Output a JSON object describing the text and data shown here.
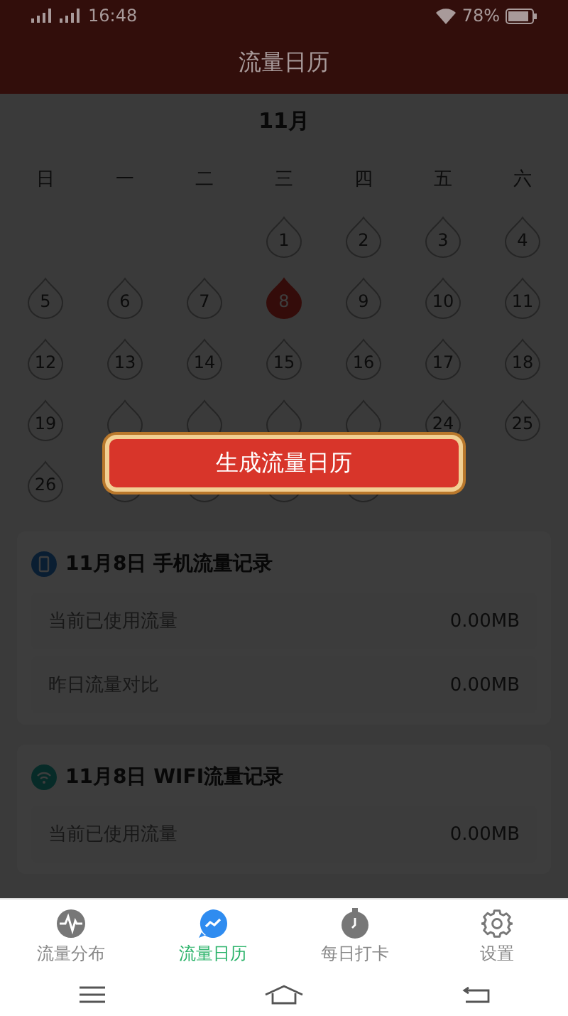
{
  "status_bar": {
    "time": "16:48",
    "battery": "78%"
  },
  "header": {
    "title": "流量日历"
  },
  "calendar": {
    "month": "11月",
    "weekdays": [
      "日",
      "一",
      "二",
      "三",
      "四",
      "五",
      "六"
    ],
    "weeks": [
      {
        "days": [
          {
            "kind": "blank"
          },
          {
            "kind": "blank"
          },
          {
            "kind": "blank"
          },
          {
            "kind": "date",
            "label": "1",
            "selected": false
          },
          {
            "kind": "date",
            "label": "2",
            "selected": false
          },
          {
            "kind": "date",
            "label": "3",
            "selected": false
          },
          {
            "kind": "date",
            "label": "4",
            "selected": false
          }
        ]
      },
      {
        "days": [
          {
            "kind": "date",
            "label": "5",
            "selected": false
          },
          {
            "kind": "date",
            "label": "6",
            "selected": false
          },
          {
            "kind": "date",
            "label": "7",
            "selected": false
          },
          {
            "kind": "date",
            "label": "8",
            "selected": true
          },
          {
            "kind": "date",
            "label": "9",
            "selected": false
          },
          {
            "kind": "date",
            "label": "10",
            "selected": false
          },
          {
            "kind": "date",
            "label": "11",
            "selected": false
          }
        ]
      },
      {
        "days": [
          {
            "kind": "date",
            "label": "12",
            "selected": false
          },
          {
            "kind": "date",
            "label": "13",
            "selected": false
          },
          {
            "kind": "date",
            "label": "14",
            "selected": false
          },
          {
            "kind": "date",
            "label": "15",
            "selected": false
          },
          {
            "kind": "date",
            "label": "16",
            "selected": false
          },
          {
            "kind": "date",
            "label": "17",
            "selected": false
          },
          {
            "kind": "date",
            "label": "18",
            "selected": false
          }
        ]
      },
      {
        "days": [
          {
            "kind": "date",
            "label": "19",
            "selected": false
          },
          {
            "kind": "covered"
          },
          {
            "kind": "covered"
          },
          {
            "kind": "covered"
          },
          {
            "kind": "covered"
          },
          {
            "kind": "date",
            "label": "24",
            "selected": false
          },
          {
            "kind": "date",
            "label": "25",
            "selected": false
          }
        ]
      },
      {
        "days": [
          {
            "kind": "date",
            "label": "26",
            "selected": false
          },
          {
            "kind": "covered"
          },
          {
            "kind": "covered"
          },
          {
            "kind": "covered"
          },
          {
            "kind": "covered"
          }
        ]
      }
    ]
  },
  "records": [
    {
      "kind": "mobile",
      "title": "11月8日 手机流量记录",
      "rows": [
        {
          "label": "当前已使用流量",
          "value": "0.00MB"
        },
        {
          "label": "昨日流量对比",
          "value": "0.00MB"
        }
      ]
    },
    {
      "kind": "wifi",
      "title": "11月8日 WIFI流量记录",
      "rows": [
        {
          "label": "当前已使用流量",
          "value": "0.00MB"
        }
      ]
    }
  ],
  "modal": {
    "dimmed": true,
    "button": "生成流量日历"
  },
  "tab_bar": [
    {
      "label": "流量分布",
      "selected": false
    },
    {
      "label": "流量日历",
      "selected": true
    },
    {
      "label": "每日打卡",
      "selected": false
    },
    {
      "label": "设置",
      "selected": false
    }
  ]
}
